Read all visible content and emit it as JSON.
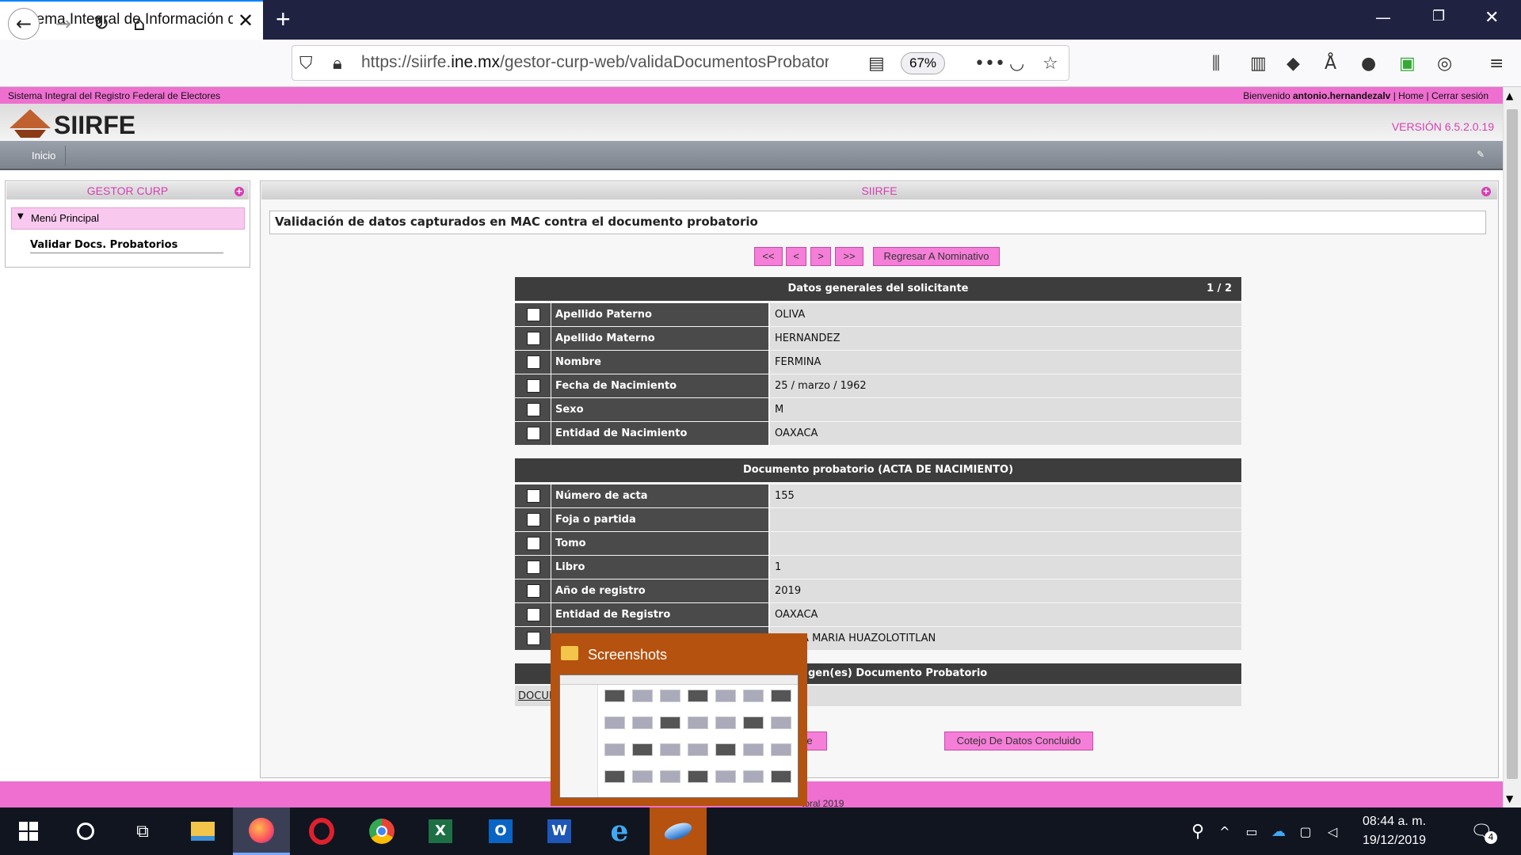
{
  "browser": {
    "tab_title": "Sistema Integral de Información del Registro Federal de Electores",
    "url_prefix": "https://siirfe.",
    "url_domain": "ine.mx",
    "url_path": "/gestor-curp-web/validaDocumentosProbatorios",
    "zoom": "67%"
  },
  "header": {
    "system_name": "Sistema Integral del Registro Federal de Electores",
    "welcome_prefix": "Bienvenido ",
    "username": "antonio.hernandezalv",
    "home_link": "Home",
    "logout_link": "Cerrar sesión",
    "separator": " | ",
    "logo_text": "SIIRFE",
    "version": "VERSIÓN 6.5.2.0.19"
  },
  "menubar": {
    "inicio": "Inicio"
  },
  "left_panel": {
    "title": "GESTOR CURP",
    "menu_label": "Menú Principal",
    "item": "Validar Docs. Probatorios"
  },
  "main_panel": {
    "title": "SIIRFE",
    "page_heading": "Validación de datos capturados en MAC contra el documento probatorio",
    "pager": {
      "first": "<<",
      "prev": "<",
      "next": ">",
      "last": ">>",
      "back": "Regresar A Nominativo"
    },
    "general": {
      "title": "Datos generales del solicitante",
      "page": "1 / 2",
      "rows": [
        {
          "label": "Apellido Paterno",
          "value": "OLIVA"
        },
        {
          "label": "Apellido Materno",
          "value": "HERNANDEZ"
        },
        {
          "label": "Nombre",
          "value": "FERMINA"
        },
        {
          "label": "Fecha de Nacimiento",
          "value": "25 / marzo / 1962"
        },
        {
          "label": "Sexo",
          "value": "M"
        },
        {
          "label": "Entidad de Nacimiento",
          "value": "OAXACA"
        }
      ]
    },
    "document": {
      "title": "Documento probatorio (ACTA DE NACIMIENTO)",
      "rows": [
        {
          "label": "Número de acta",
          "value": "155"
        },
        {
          "label": "Foja o partida",
          "value": ""
        },
        {
          "label": "Tomo",
          "value": ""
        },
        {
          "label": "Libro",
          "value": "1"
        },
        {
          "label": "Año de registro",
          "value": "2019"
        },
        {
          "label": "Entidad de Registro",
          "value": "OAXACA"
        },
        {
          "label": "",
          "value": "SANTA MARIA HUAZOLOTITLAN"
        }
      ]
    },
    "images_title": "gen(es) Documento Probatorio",
    "doc_link": "DOCUN",
    "btn_left_partial": "ole",
    "btn_cotejo": "Cotejo De Datos Concluido"
  },
  "footer": {
    "partial_text": "toral 2019"
  },
  "popup": {
    "title": "Screenshots"
  },
  "taskbar": {
    "time": "08:44 a. m.",
    "date": "19/12/2019",
    "notifications": "4"
  },
  "colors": {
    "accent_pink": "#ee6fd0",
    "brand_magenta": "#d63fb5",
    "table_dark": "#3d3d3d",
    "taskbar": "#101520",
    "popup_orange": "#b5520f"
  }
}
